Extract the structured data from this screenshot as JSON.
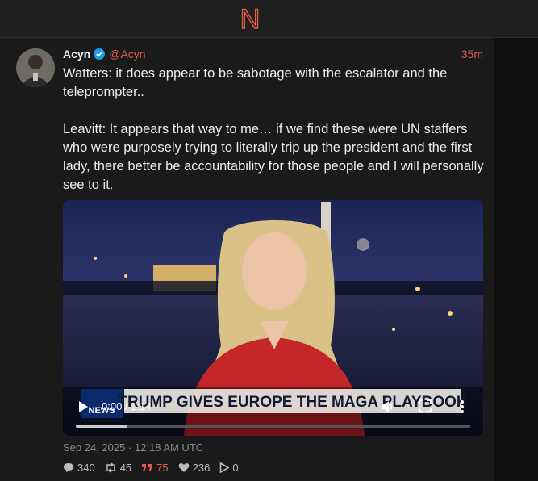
{
  "app": {
    "logo_letter": "N",
    "accent": "#e35a4a"
  },
  "tweet": {
    "author_name": "Acyn",
    "handle": "@Acyn",
    "relative_time": "35m",
    "text": "Watters: it does appear to be sabotage with the escalator and the teleprompter..\n\nLeavitt: It appears that way to me… if we find these were UN staffers who were purposely trying to literally trip up the president and the first lady, there better be accountability for those people and I will personally see to it.",
    "date": "Sep 24, 2025 · 12:18 AM UTC"
  },
  "video": {
    "time_display": "0:00 / 1:14",
    "progress": 0.13,
    "chyron": "TRUMP GIVES EUROPE THE MAGA PLAYBOOK",
    "network_logo": "NEWS",
    "icons": {
      "play": "play-icon",
      "volume": "volume-icon",
      "fullscreen": "fullscreen-icon",
      "more": "more-vertical-icon"
    }
  },
  "stats": {
    "replies": "340",
    "retweets": "45",
    "quotes": "75",
    "likes": "236",
    "plays": "0"
  }
}
